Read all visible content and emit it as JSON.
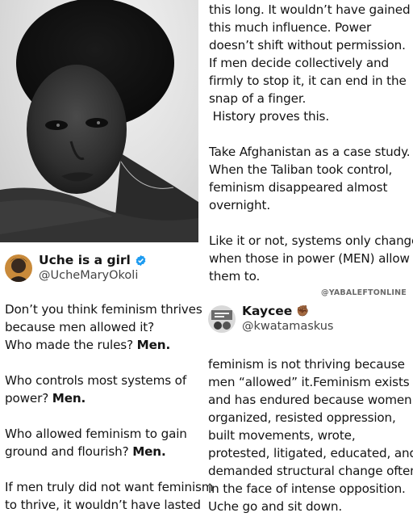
{
  "left_tweet": {
    "author_name": "Uche is a girl",
    "author_handle": "@UcheMaryOkoli",
    "lines": [
      {
        "pre": "Don’t you think feminism thrives",
        "bold": ""
      },
      {
        "pre": "because men allowed it?",
        "bold": ""
      },
      {
        "pre": "Who made the rules? ",
        "bold": "Men."
      },
      {
        "pre": "Who controls most systems of",
        "bold": ""
      },
      {
        "pre": "power? ",
        "bold": "Men."
      },
      {
        "pre": "Who allowed feminism to gain",
        "bold": ""
      },
      {
        "pre": "ground and flourish? ",
        "bold": "Men."
      },
      {
        "pre": "If men truly did not want feminism",
        "bold": ""
      },
      {
        "pre": "to thrive, it wouldn’t have lasted",
        "bold": ""
      }
    ]
  },
  "right_continuation": {
    "lines": [
      "this long. It wouldn’t have gained",
      "this much influence. Power",
      "doesn’t shift without permission.",
      "If men decide collectively and",
      "firmly to stop it, it can end in the",
      "snap of a finger.",
      " History proves this.",
      "Take Afghanistan as a case study.",
      "When the Taliban took control,",
      "feminism disappeared almost",
      "overnight.",
      "Like it or not, systems only change",
      "when those in power (MEN) allow",
      "them to."
    ]
  },
  "watermark": "@YABALEFTONLINE",
  "reply_tweet": {
    "author_name": "Kaycee",
    "author_emoji": "✊🏾",
    "author_handle": "@kwatamaskus",
    "lines": [
      "feminism is not thriving because",
      "men “allowed” it.Feminism exists",
      "and has endured because women",
      "organized, resisted oppression,",
      "built movements, wrote,",
      "protested, litigated, educated, and",
      "demanded structural change often",
      "in the face of intense opposition.",
      "Uche go and sit down."
    ]
  },
  "colors": {
    "verified": "#1d9bf0",
    "text": "#141414",
    "handle": "#444444"
  }
}
